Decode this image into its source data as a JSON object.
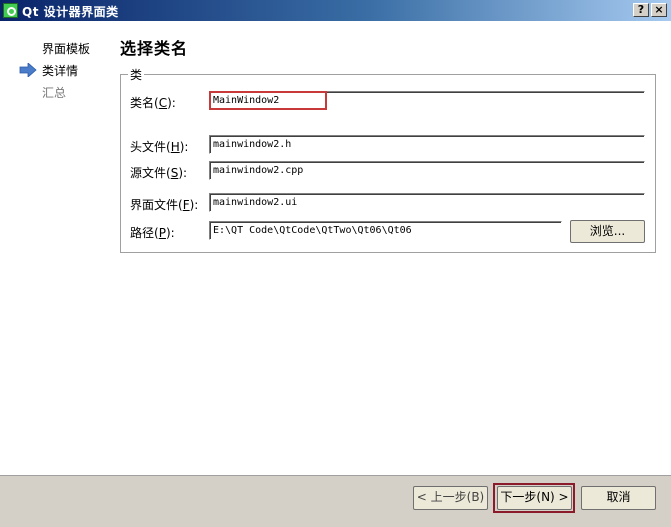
{
  "window": {
    "title": "Qt 设计器界面类",
    "help_label": "?",
    "close_label": "×"
  },
  "sidebar": {
    "items": [
      {
        "label": "界面模板"
      },
      {
        "label": "类详情"
      },
      {
        "label": "汇总"
      }
    ]
  },
  "page": {
    "title": "选择类名",
    "group_label": "类"
  },
  "form": {
    "class_name": {
      "label": "类名",
      "mnemonic": "C",
      "value": "MainWindow2"
    },
    "header_file": {
      "label": "头文件",
      "mnemonic": "H",
      "value": "mainwindow2.h"
    },
    "source_file": {
      "label": "源文件",
      "mnemonic": "S",
      "value": "mainwindow2.cpp"
    },
    "form_file": {
      "label": "界面文件",
      "mnemonic": "F",
      "value": "mainwindow2.ui"
    },
    "path": {
      "label": "路径",
      "mnemonic": "P",
      "value": "E:\\QT Code\\QtCode\\QtTwo\\Qt06\\Qt06"
    }
  },
  "buttons": {
    "browse": "浏览...",
    "back": "< 上一步(B)",
    "next": "下一步(N) >",
    "cancel": "取消"
  }
}
